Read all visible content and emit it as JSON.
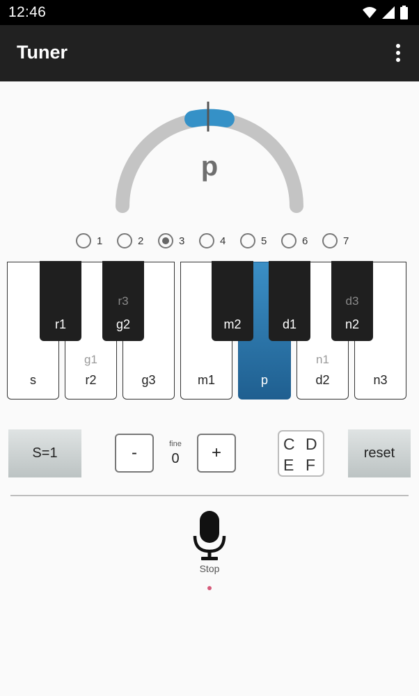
{
  "status": {
    "time": "12:46"
  },
  "appbar": {
    "title": "Tuner"
  },
  "tuner": {
    "note": "p"
  },
  "octaves": {
    "options": [
      "1",
      "2",
      "3",
      "4",
      "5",
      "6",
      "7"
    ],
    "selected": "3"
  },
  "keyboard": {
    "white": [
      {
        "label": "s"
      },
      {
        "label": "r2",
        "alt": "g1"
      },
      {
        "label": "g3"
      },
      {
        "label": "m1"
      },
      {
        "label": "p",
        "active": true
      },
      {
        "label": "d2",
        "alt": "n1"
      },
      {
        "label": "n3"
      }
    ],
    "black": [
      {
        "label": "r1"
      },
      {
        "label": "g2",
        "alt": "r3"
      },
      {
        "label": "m2"
      },
      {
        "label": "d1"
      },
      {
        "label": "n2",
        "alt": "d3"
      }
    ]
  },
  "controls": {
    "s_button": "S=1",
    "minus": "-",
    "plus": "+",
    "fine_label": "fine",
    "fine_value": "0",
    "cdef": [
      "C",
      "D",
      "E",
      "F"
    ],
    "reset": "reset"
  },
  "mic": {
    "label": "Stop"
  },
  "colors": {
    "accent": "#3591c7",
    "appbar": "#212121",
    "gauge_track": "#c4c4c4"
  },
  "icons": [
    "wifi-icon",
    "signal-icon",
    "battery-icon",
    "more-vert-icon",
    "microphone-icon"
  ]
}
